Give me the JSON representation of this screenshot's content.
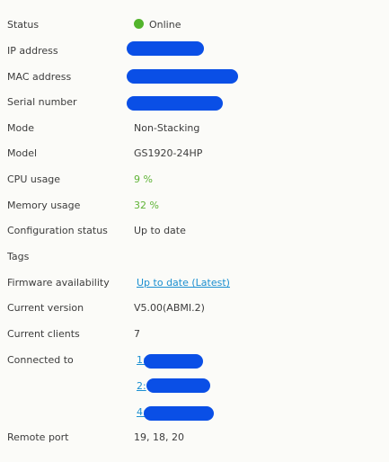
{
  "rows": {
    "status": {
      "label": "Status",
      "value": "Online",
      "icon": "status-online-dot-icon"
    },
    "ip_address": {
      "label": "IP address"
    },
    "mac_address": {
      "label": "MAC address"
    },
    "serial_number": {
      "label": "Serial number"
    },
    "mode": {
      "label": "Mode",
      "value": "Non-Stacking"
    },
    "model": {
      "label": "Model",
      "value": "GS1920-24HP"
    },
    "cpu_usage": {
      "label": "CPU usage",
      "value": "9 %"
    },
    "memory_usage": {
      "label": "Memory usage",
      "value": "32 %"
    },
    "configuration_status": {
      "label": "Configuration status",
      "value": "Up to date"
    },
    "tags": {
      "label": "Tags",
      "value": ""
    },
    "firmware_availability": {
      "label": "Firmware availability",
      "value": "Up to date (Latest)"
    },
    "current_version": {
      "label": "Current version",
      "value": "V5.00(ABMI.2)"
    },
    "current_clients": {
      "label": "Current clients",
      "value": "7"
    },
    "connected_to": {
      "label": "Connected to",
      "links": [
        "1:",
        "2:",
        "4:"
      ]
    },
    "remote_port": {
      "label": "Remote port",
      "value": "19, 18, 20"
    }
  },
  "colors": {
    "background": "#fbfbf8",
    "text": "#3c3c3c",
    "accent_green": "#5fb336",
    "link_blue": "#1b8fd1",
    "redaction_blue": "#0a4fe6"
  }
}
